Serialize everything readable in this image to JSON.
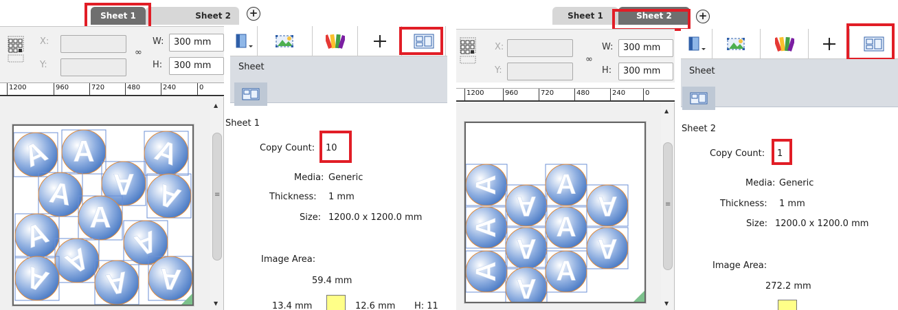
{
  "left": {
    "tabs": [
      {
        "label": "Sheet 1",
        "active": true
      },
      {
        "label": "Sheet 2",
        "active": false
      }
    ],
    "add_tab": "+",
    "fields": {
      "x_label": "X:",
      "x_value": "",
      "y_label": "Y:",
      "y_value": "",
      "w_label": "W:",
      "w_value": "300 mm",
      "h_label": "H:",
      "h_value": "300 mm",
      "link": "∞"
    },
    "ruler": [
      "1200",
      "960",
      "720",
      "480",
      "240",
      "0"
    ],
    "panel": {
      "title": "Sheet",
      "name": "Sheet 1",
      "copy_count_label": "Copy Count:",
      "copy_count": "10",
      "media_label": "Media:",
      "media": "Generic",
      "thickness_label": "Thickness:",
      "thickness": "1 mm",
      "size_label": "Size:",
      "size": "1200.0 x 1200.0 mm",
      "image_area_label": "Image Area:",
      "top_margin": "59.4 mm",
      "left_margin": "13.4 mm",
      "right_margin": "12.6 mm",
      "h_label": "H: 11"
    }
  },
  "right": {
    "tabs": [
      {
        "label": "Sheet 1",
        "active": false
      },
      {
        "label": "Sheet 2",
        "active": true
      }
    ],
    "add_tab": "+",
    "fields": {
      "x_label": "X:",
      "x_value": "",
      "y_label": "Y:",
      "y_value": "",
      "w_label": "W:",
      "w_value": "300 mm",
      "h_label": "H:",
      "h_value": "300 mm",
      "link": "∞"
    },
    "ruler": [
      "1200",
      "960",
      "720",
      "480",
      "240",
      "0"
    ],
    "panel": {
      "title": "Sheet",
      "name": "Sheet 2",
      "copy_count_label": "Copy Count:",
      "copy_count": "1",
      "media_label": "Media:",
      "media": "Generic",
      "thickness_label": "Thickness:",
      "thickness": "1 mm",
      "size_label": "Size:",
      "size": "1200.0 x 1200.0 mm",
      "image_area_label": "Image Area:",
      "top_margin": "272.2 mm"
    }
  },
  "icons": {
    "toolbar": [
      "panel-toggle-icon",
      "image-select-icon",
      "color-swatches-icon",
      "crosshair-icon",
      "sheet-view-icon"
    ],
    "nested_item_glyph": "A"
  },
  "colors": {
    "highlight": "#e11d26",
    "tab_active": "#6f6f6f",
    "tab_inactive": "#d7d7d7",
    "panel_header": "#d9dde3",
    "item_blue": "#3f72c0",
    "item_outline": "#e08a3a",
    "bbox_blue": "#6b8fd6",
    "corner_green": "#7cc18c"
  }
}
